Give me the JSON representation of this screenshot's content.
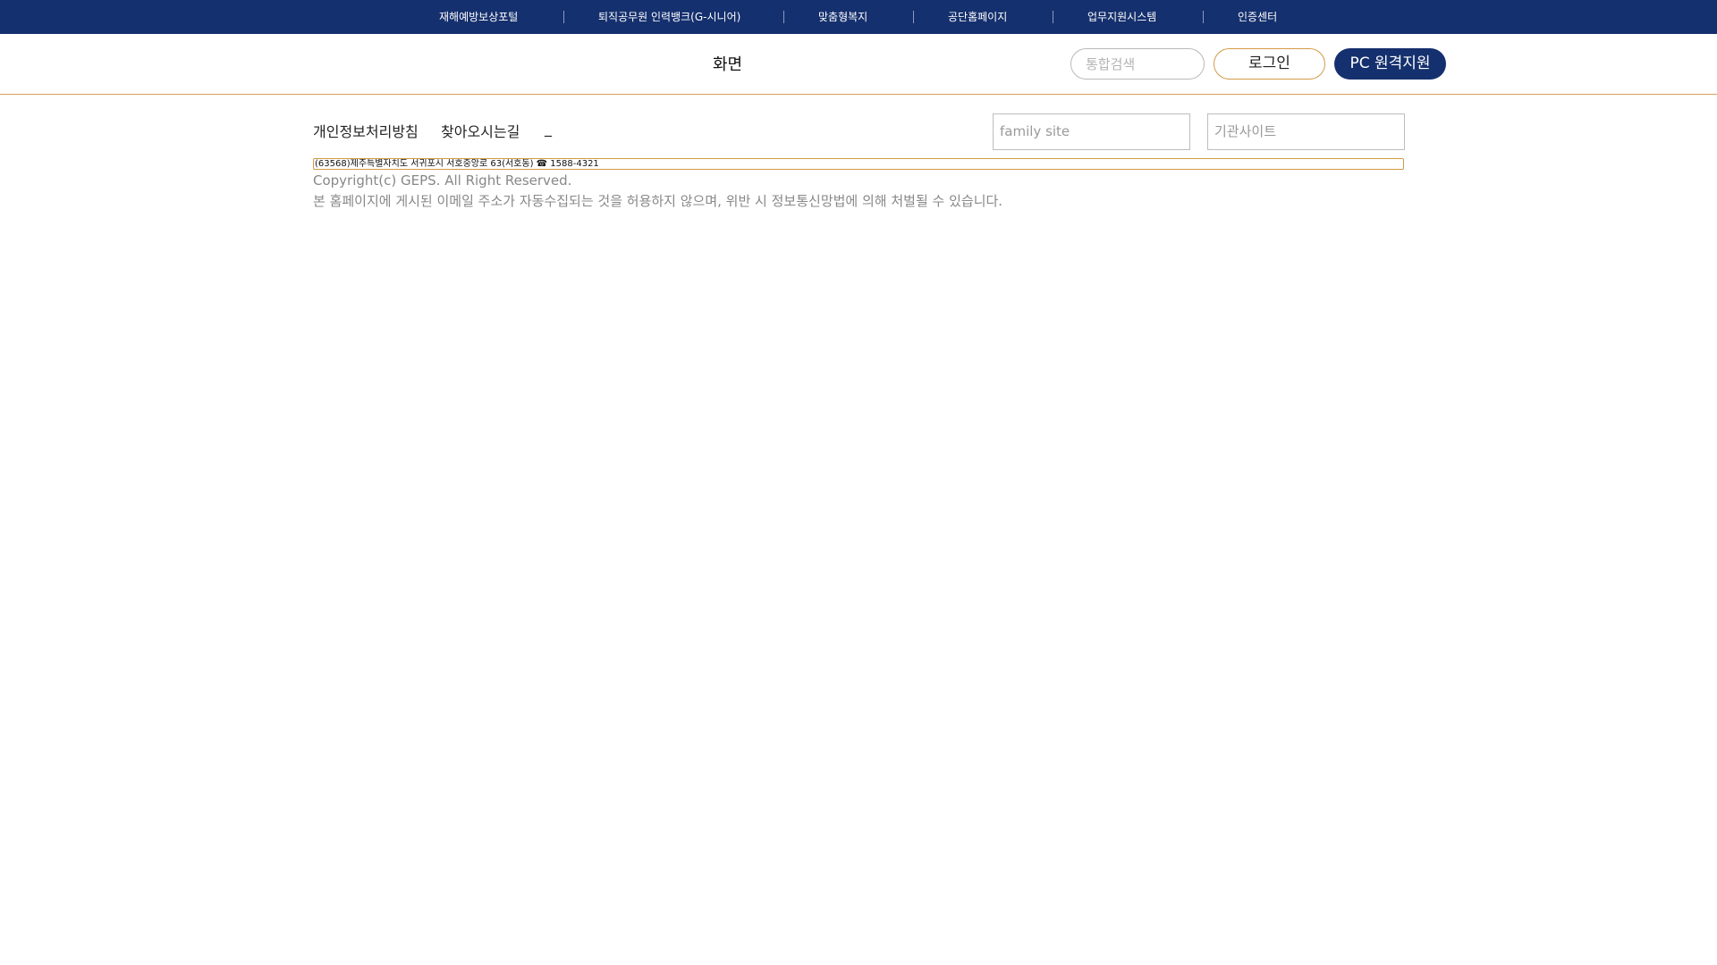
{
  "topbar": {
    "items": [
      {
        "label": "재해예방보상포털"
      },
      {
        "label": "퇴직공무원 인력뱅크(G-시니어)"
      },
      {
        "label": "맞춤형복지"
      },
      {
        "label": "공단홈페이지"
      },
      {
        "label": "업무지원시스템"
      },
      {
        "label": "인증센터"
      }
    ]
  },
  "header": {
    "title": "화면",
    "search_placeholder": "통합검색",
    "login_label": "로그인",
    "remote_label": "PC 원격지원"
  },
  "footer": {
    "links": [
      {
        "label": "개인정보처리방침"
      },
      {
        "label": "찾아오시는길"
      },
      {
        "label": "_"
      }
    ],
    "family_site": "family site",
    "agency_site": "기관사이트",
    "address": "(63568)제주특별자치도 서귀포시 서호중앙로 63(서호동)  ☎ 1588-4321",
    "copyright": "Copyright(c) GEPS. All Right Reserved.",
    "notice": "본 홈페이지에 게시된 이메일 주소가 자동수집되는 것을 허용하지 않으며, 위반 시 정보통신망법에 의해 처벌될 수 있습니다."
  },
  "colors": {
    "brand_navy": "#15306e",
    "accent_gold": "#d39a47"
  }
}
